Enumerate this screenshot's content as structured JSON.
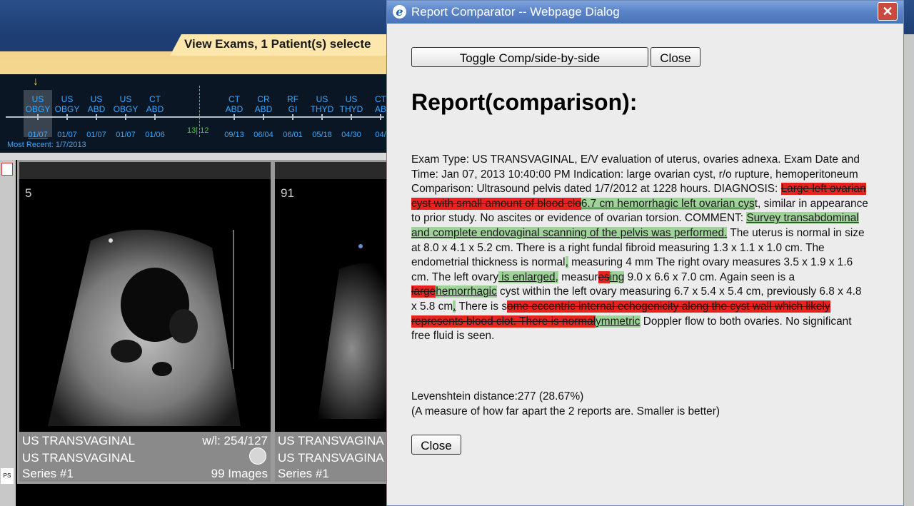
{
  "background": {
    "tab_title": "View Exams, 1 Patient(s) selecte",
    "exams": [
      {
        "modality": "US",
        "body": "OBGY",
        "date": "01/07"
      },
      {
        "modality": "US",
        "body": "OBGY",
        "date": "01/07"
      },
      {
        "modality": "US",
        "body": "ABD",
        "date": "01/07"
      },
      {
        "modality": "US",
        "body": "OBGY",
        "date": "01/07"
      },
      {
        "modality": "CT",
        "body": "ABD",
        "date": "01/06"
      },
      {
        "modality": "CT",
        "body": "ABD",
        "date": "09/13"
      },
      {
        "modality": "CR",
        "body": "ABD",
        "date": "06/04"
      },
      {
        "modality": "RF",
        "body": "GI",
        "date": "06/01"
      },
      {
        "modality": "US",
        "body": "THYD",
        "date": "05/18"
      },
      {
        "modality": "US",
        "body": "THYD",
        "date": "04/30"
      },
      {
        "modality": "CT",
        "body": "AB",
        "date": "04/"
      }
    ],
    "year_marker": "13| 12",
    "most_recent": "Most Recent: 1/7/2013",
    "viewer1": {
      "series_number": "5",
      "line1": "US TRANSVAGINAL",
      "wl": "w/l: 254/127",
      "line2": "US TRANSVAGINAL",
      "series": "Series #1",
      "images": "99 Images"
    },
    "viewer2": {
      "series_number": "91",
      "line1": "US TRANSVAGINA",
      "line2": "US TRANSVAGINA",
      "series": "Series #1"
    }
  },
  "dialog": {
    "title": "Report Comparator -- Webpage Dialog",
    "toggle_label": "Toggle Comp/side-by-side",
    "close_label": "Close",
    "heading": "Report(comparison):",
    "report_segments": [
      {
        "t": "Exam Type: US TRANSVAGINAL, E/V evaluation of uterus, ovaries adnexa. Exam Date and Time: Jan 07, 2013 10:40:00 PM Indication: large ovarian cyst, r/o rupture, hemoperitoneum Comparison: Ultrasound pelvis dated 1/7/2012 at 1228 hours. DIAGNOSIS: ",
        "k": "n"
      },
      {
        "t": "Large left ovarian cyst with small amount of blood clo",
        "k": "d"
      },
      {
        "t": "6.7 cm hemorrhagic left ovarian cys",
        "k": "i"
      },
      {
        "t": "t, similar in appearance to prior study. No ascites or evidence of ovarian torsion.  COMMENT: ",
        "k": "n"
      },
      {
        "t": "Survey transabdominal and complete endovaginal scanning of the pelvis was performed.",
        "k": "i"
      },
      {
        "t": "  The uterus is normal in size at 8.0 x 4.1 x 5.2 cm. There is a right fundal fibroid measuring 1.3 x 1.1 x 1.0 cm. The endometrial thickness is normal",
        "k": "n"
      },
      {
        "t": ",",
        "k": "i"
      },
      {
        "t": " measuring 4 mm  The right ovary measures 3.5 x 1.9 x 1.6 cm. The left ovary",
        "k": "n"
      },
      {
        "t": " is enlarged,",
        "k": "i"
      },
      {
        "t": " measur",
        "k": "n"
      },
      {
        "t": "es",
        "k": "d"
      },
      {
        "t": "ing",
        "k": "i"
      },
      {
        "t": " 9.0 x 6.6 x 7.0 cm. Again seen is a ",
        "k": "n"
      },
      {
        "t": "large",
        "k": "d"
      },
      {
        "t": "hemorrhagic",
        "k": "i"
      },
      {
        "t": " cyst within the left ovary measuring 6.7 x 5.4 x 5.4 cm, previously 6.8 x 4.8 x 5.8 cm",
        "k": "n"
      },
      {
        "t": ".",
        "k": "i"
      },
      {
        "t": " There is s",
        "k": "n"
      },
      {
        "t": "ome eccentric internal echogenicity along the cyst wall which likely represents blood clot. There is normal",
        "k": "d"
      },
      {
        "t": "ymmetric",
        "k": "i"
      },
      {
        "t": " Doppler flow to both ovaries.  No significant free fluid is seen.",
        "k": "n"
      }
    ],
    "levenshtein": "Levenshtein distance:277 (28.67%)",
    "levenshtein_note": "(A measure of how far apart the 2 reports are. Smaller is better)",
    "colors": {
      "deleted": "#e8231f",
      "inserted": "#9fd39a"
    }
  }
}
